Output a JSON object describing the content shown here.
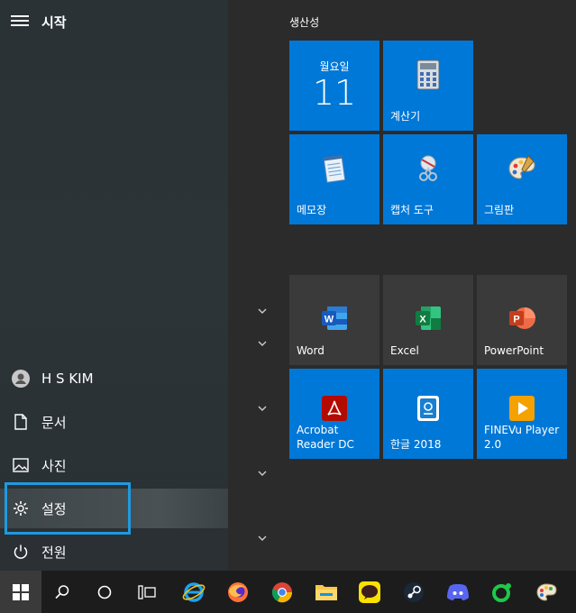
{
  "start": {
    "title": "시작"
  },
  "rail": {
    "user": "H S KIM",
    "documents": "문서",
    "pictures": "사진",
    "settings": "설정",
    "power": "전원"
  },
  "group": {
    "title": "생산성"
  },
  "tiles": {
    "calendar": {
      "day": "월요일",
      "date": "11"
    },
    "calculator": "계산기",
    "notepad": "메모장",
    "snipping": "캡처 도구",
    "paint": "그림판",
    "word": "Word",
    "excel": "Excel",
    "powerpoint": "PowerPoint",
    "acrobat_line1": "Acrobat",
    "acrobat_line2": "Reader DC",
    "hangul": "한글 2018",
    "finevu_line1": "FINEVu Player",
    "finevu_line2": "2.0"
  },
  "colors": {
    "tile_blue": "#0078d7",
    "highlight": "#1e9ae0",
    "taskbar": "#1c1c1c"
  }
}
